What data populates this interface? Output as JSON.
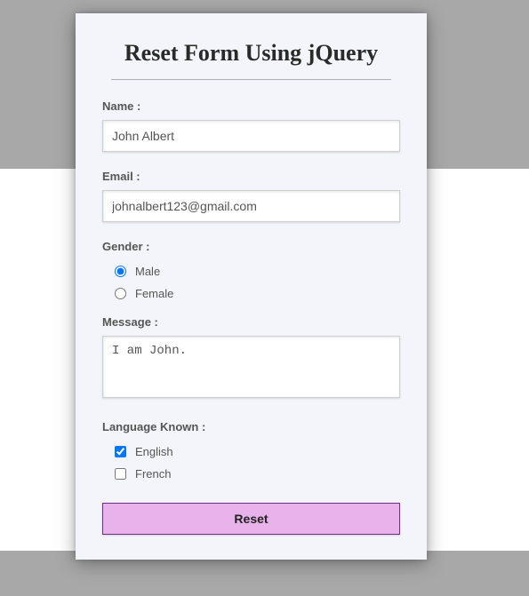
{
  "title": "Reset Form Using jQuery",
  "fields": {
    "name": {
      "label": "Name :",
      "value": "John Albert"
    },
    "email": {
      "label": "Email :",
      "value": "johnalbert123@gmail.com"
    },
    "gender": {
      "label": "Gender :",
      "options": [
        {
          "label": "Male",
          "checked": true
        },
        {
          "label": "Female",
          "checked": false
        }
      ]
    },
    "message": {
      "label": "Message :",
      "value": "I am John."
    },
    "language": {
      "label": "Language Known :",
      "options": [
        {
          "label": "English",
          "checked": true
        },
        {
          "label": "French",
          "checked": false
        }
      ]
    }
  },
  "reset_label": "Reset"
}
